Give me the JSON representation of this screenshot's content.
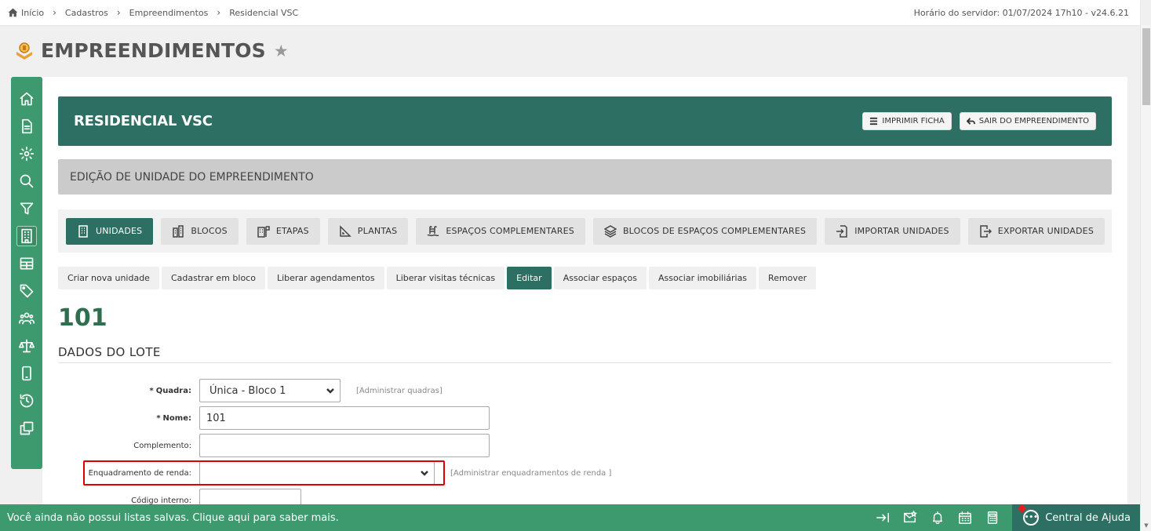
{
  "breadcrumb": {
    "items": [
      "Início",
      "Cadastros",
      "Empreendimentos",
      "Residencial VSC"
    ]
  },
  "server_time": "Horário do servidor: 01/07/2024 17h10 - v24.6.21",
  "page": {
    "title": "EMPREENDIMENTOS"
  },
  "sidebar": {
    "icons": [
      "home-icon",
      "document-icon",
      "settings-icon",
      "search-icon",
      "filter-icon",
      "building-icon",
      "table-icon",
      "tag-icon",
      "users-icon",
      "scale-icon",
      "mobile-icon",
      "history-icon",
      "copy-icon"
    ],
    "active_index": 5
  },
  "enterprise": {
    "name": "RESIDENCIAL VSC",
    "print_label": "IMPRIMIR FICHA",
    "exit_label": "SAIR DO EMPREENDIMENTO"
  },
  "section": {
    "title": "EDIÇÃO DE UNIDADE DO EMPREENDIMENTO"
  },
  "tabs": [
    {
      "label": "UNIDADES",
      "icon": "building-icon",
      "active": true
    },
    {
      "label": "BLOCOS",
      "icon": "blocks-icon",
      "active": false
    },
    {
      "label": "ETAPAS",
      "icon": "stages-icon",
      "active": false
    },
    {
      "label": "PLANTAS",
      "icon": "blueprint-icon",
      "active": false
    },
    {
      "label": "ESPAÇOS COMPLEMENTARES",
      "icon": "pool-icon",
      "active": false
    },
    {
      "label": "BLOCOS DE ESPAÇOS COMPLEMENTARES",
      "icon": "layers-icon",
      "active": false
    },
    {
      "label": "IMPORTAR UNIDADES",
      "icon": "import-icon",
      "active": false
    },
    {
      "label": "EXPORTAR UNIDADES",
      "icon": "export-icon",
      "active": false
    }
  ],
  "actions": [
    {
      "label": "Criar nova unidade",
      "active": false
    },
    {
      "label": "Cadastrar em bloco",
      "active": false
    },
    {
      "label": "Liberar agendamentos",
      "active": false
    },
    {
      "label": "Liberar visitas técnicas",
      "active": false
    },
    {
      "label": "Editar",
      "active": true
    },
    {
      "label": "Associar espaços",
      "active": false
    },
    {
      "label": "Associar imobiliárias",
      "active": false
    },
    {
      "label": "Remover",
      "active": false
    }
  ],
  "unit": {
    "number": "101"
  },
  "form": {
    "group_title": "DADOS DO LOTE",
    "quadra": {
      "required_mark": "*",
      "label": "Quadra:",
      "value": "Única - Bloco 1",
      "admin_link": "[Administrar quadras]"
    },
    "nome": {
      "required_mark": "*",
      "label": "Nome:",
      "value": "101"
    },
    "complemento": {
      "label": "Complemento:",
      "value": ""
    },
    "enquadramento": {
      "label": "Enquadramento de renda:",
      "value": "",
      "admin_link": "[Administrar enquadramentos de renda ]"
    },
    "codigo_interno": {
      "label": "Código interno:",
      "value": ""
    }
  },
  "bottom_bar": {
    "message": "Você ainda não possui listas salvas. Clique aqui para saber mais.",
    "help_label": "Central de Ajuda",
    "icons": [
      "exit-arrow-icon",
      "mail-star-icon",
      "bell-icon",
      "calendar-icon",
      "calculator-icon"
    ],
    "notification_color": "#e0201f"
  },
  "colors": {
    "brand_green": "#3d9a6e",
    "dark_green": "#2e6f63",
    "highlight_red": "#e00000"
  }
}
